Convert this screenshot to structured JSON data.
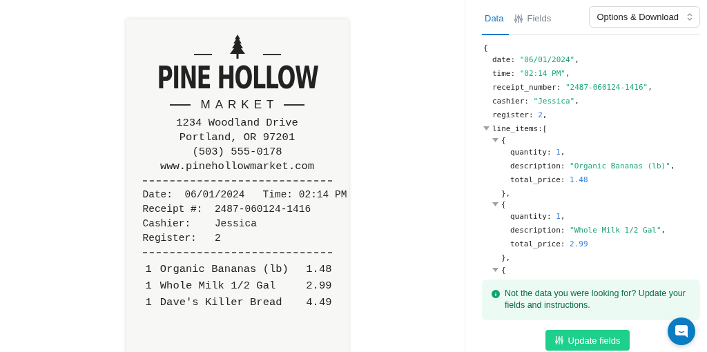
{
  "receipt": {
    "brand": "PINE HOLLOW",
    "subtitle": "MARKET",
    "address": [
      "1234 Woodland Drive",
      "Portland, OR  97201",
      "(503) 555-0178",
      "www.pinehollowmarket.com"
    ],
    "details": [
      "Date:  06/01/2024   Time: 02:14 PM",
      "Receipt #:  2487-060124-1416",
      "Cashier:    Jessica",
      "Register:   2"
    ],
    "items": [
      {
        "qty": "1",
        "description": "Organic Bananas (lb)",
        "price": "1.48"
      },
      {
        "qty": "1",
        "description": "Whole Milk 1/2 Gal",
        "price": "2.99"
      },
      {
        "qty": "1",
        "description": "Dave's Killer Bread",
        "price": "4.49"
      }
    ]
  },
  "tabs": [
    {
      "label": "Data",
      "selected": true
    },
    {
      "label": "Fields",
      "selected": false
    }
  ],
  "options_select": {
    "value": "Options & Download"
  },
  "viewer": {
    "root": {
      "open": "{",
      "children": [
        {
          "key": "date:",
          "value": "\"06/01/2024\"",
          "kind": "string",
          "punct": ","
        },
        {
          "key": "time:",
          "value": "\"02:14 PM\"",
          "kind": "string",
          "punct": ","
        },
        {
          "key": "receipt_number:",
          "value": "\"2487-060124-1416\"",
          "kind": "string",
          "punct": ","
        },
        {
          "key": "cashier:",
          "value": "\"Jessica\"",
          "kind": "string",
          "punct": ","
        },
        {
          "key": "register:",
          "value": "2",
          "kind": "number",
          "punct": ","
        },
        {
          "key": "line_items:",
          "open": "[",
          "expanded": true,
          "children": [
            {
              "open": "{",
              "expanded": true,
              "close": "},",
              "children": [
                {
                  "key": "quantity:",
                  "value": "1",
                  "kind": "number",
                  "punct": ","
                },
                {
                  "key": "description:",
                  "value": "\"Organic Bananas (lb)\"",
                  "kind": "string",
                  "punct": ","
                },
                {
                  "key": "total_price:",
                  "value": "1.48",
                  "kind": "number"
                }
              ]
            },
            {
              "open": "{",
              "expanded": true,
              "close": "},",
              "children": [
                {
                  "key": "quantity:",
                  "value": "1",
                  "kind": "number",
                  "punct": ","
                },
                {
                  "key": "description:",
                  "value": "\"Whole Milk 1/2 Gal\"",
                  "kind": "string",
                  "punct": ","
                },
                {
                  "key": "total_price:",
                  "value": "2.99",
                  "kind": "number"
                }
              ]
            },
            {
              "open": "{",
              "expanded": true
            }
          ]
        }
      ]
    }
  },
  "notice": {
    "text": "Not the data you were looking for? Update your fields and instructions."
  },
  "update_button": {
    "label": "Update fields"
  }
}
